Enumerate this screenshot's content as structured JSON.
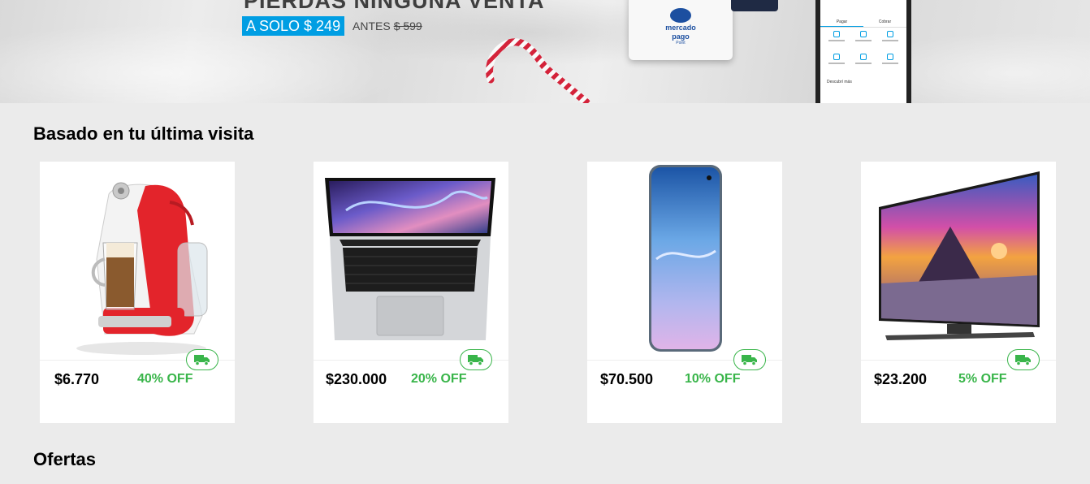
{
  "banner": {
    "headline": "PIERDAS NINGUNA VENTA",
    "promo_price": "A SOLO $ 249",
    "before_label": "ANTES",
    "before_price": "$ 599",
    "reader_brand_line1": "mercado",
    "reader_brand_line2": "pago",
    "reader_brand_line3": "Point",
    "phone_tab_1": "Pagar",
    "phone_tab_2": "Cobrar",
    "phone_more": "Descubrí más"
  },
  "sections": {
    "recent_title": "Basado en tu última visita",
    "offers_title": "Ofertas"
  },
  "products": [
    {
      "price": "$6.770",
      "discount": "40% OFF",
      "image": "coffee-machine-image",
      "free_shipping": true
    },
    {
      "price": "$230.000",
      "discount": "20% OFF",
      "image": "laptop-image",
      "free_shipping": true
    },
    {
      "price": "$70.500",
      "discount": "10% OFF",
      "image": "smartphone-image",
      "free_shipping": true
    },
    {
      "price": "$23.200",
      "discount": "5% OFF",
      "image": "television-image",
      "free_shipping": true
    }
  ],
  "colors": {
    "page_bg": "#ebebeb",
    "discount_green": "#39b54a",
    "promo_blue": "#009ee3"
  }
}
